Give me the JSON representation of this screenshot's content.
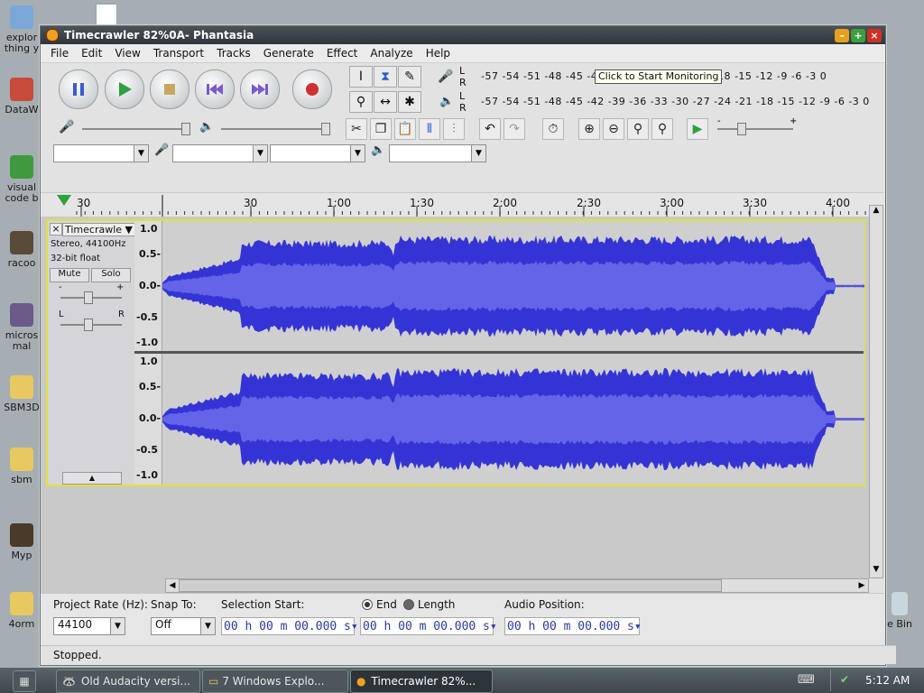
{
  "desktop": {
    "icons": [
      {
        "label": "explor thing y",
        "color": "#7aa7d8"
      },
      {
        "label": "DataW",
        "color": "#c84a3a"
      },
      {
        "label": "visual code b",
        "color": "#3f9a3f"
      },
      {
        "label": "racoo",
        "color": "#5a4a3a"
      },
      {
        "label": "micros mal",
        "color": "#6a5a8a"
      },
      {
        "label": "SBM3D",
        "color": "#e8c860"
      },
      {
        "label": "sbm",
        "color": "#e8c860"
      },
      {
        "label": "Myp",
        "color": "#4a3a2a"
      },
      {
        "label": "4orm",
        "color": "#e8c860"
      }
    ],
    "right_icon_label": "e Bin"
  },
  "window": {
    "title": "Timecrawler 82%0A- Phantasia",
    "controls": {
      "minimize": "–",
      "maximize": "+",
      "close": "×"
    }
  },
  "menu": [
    "File",
    "Edit",
    "View",
    "Transport",
    "Tracks",
    "Generate",
    "Effect",
    "Analyze",
    "Help"
  ],
  "meters": {
    "scale_top": "-57 -54 -51 -48 -45 -42 -3",
    "scale_top_right": "1 -18 -15 -12  -9  -6  -3  0",
    "scale_bottom": "-57 -54 -51 -48 -45 -42 -39 -36 -33 -30 -27 -24 -21 -18 -15 -12  -9  -6  -3  0",
    "tooltip": "Click to Start Monitoring",
    "left_channel": "L",
    "right_channel": "R"
  },
  "sliders": {
    "minus": "-",
    "plus": "+"
  },
  "ruler": {
    "labels": [
      {
        "t": "30",
        "pos": 37
      },
      {
        "t": "30",
        "pos": 225
      },
      {
        "t": "1:00",
        "pos": 317
      },
      {
        "t": "1:30",
        "pos": 409
      },
      {
        "t": "2:00",
        "pos": 501
      },
      {
        "t": "2:30",
        "pos": 594
      },
      {
        "t": "3:00",
        "pos": 686
      },
      {
        "t": "3:30",
        "pos": 778
      },
      {
        "t": "4:00",
        "pos": 870
      }
    ]
  },
  "track": {
    "name": "Timecrawle",
    "format": "Stereo, 44100Hz",
    "bits": "32-bit float",
    "mute": "Mute",
    "solo": "Solo",
    "gain_minus": "-",
    "gain_plus": "+",
    "pan_left": "L",
    "pan_right": "R",
    "scale": [
      "1.0",
      "0.5-",
      "0.0-",
      "-0.5",
      "-1.0"
    ],
    "wave_color": "#3434d6",
    "wave_rms_color": "#6464e8"
  },
  "selection_bar": {
    "project_rate_label": "Project Rate (Hz):",
    "project_rate_value": "44100",
    "snap_to_label": "Snap To:",
    "snap_to_value": "Off",
    "selection_start_label": "Selection Start:",
    "end_label": "End",
    "length_label": "Length",
    "audio_position_label": "Audio Position:",
    "time_value": "00 h 00 m 00.000 s▾"
  },
  "status": "Stopped.",
  "taskbar": {
    "items": [
      {
        "label": "Old Audacity versi..."
      },
      {
        "label": "7 Windows Explo..."
      },
      {
        "label": "Timecrawler 82%..."
      }
    ],
    "clock": "5:12 AM"
  }
}
